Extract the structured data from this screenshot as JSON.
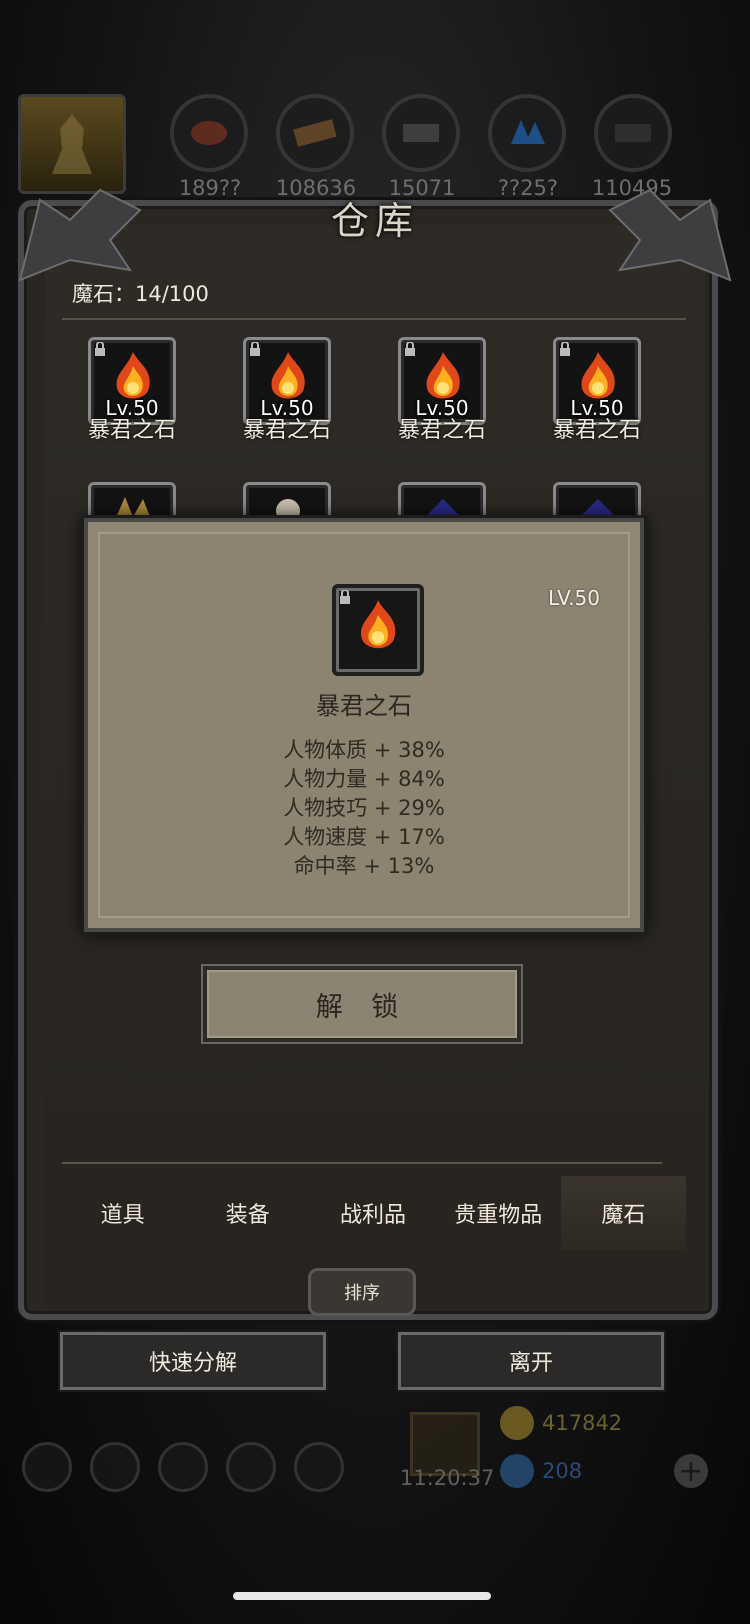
{
  "resources": {
    "values": [
      "189??",
      "108636",
      "15071",
      "??25?",
      "110495"
    ]
  },
  "warehouse": {
    "title": "仓库",
    "count_label": "魔石：14/100"
  },
  "items": [
    {
      "name": "暴君之石",
      "level": "Lv.50"
    },
    {
      "name": "暴君之石",
      "level": "Lv.50"
    },
    {
      "name": "暴君之石",
      "level": "Lv.50"
    },
    {
      "name": "暴君之石",
      "level": "Lv.50"
    }
  ],
  "popup": {
    "level": "LV.50",
    "name": "暴君之石",
    "stats": [
      "人物体质 + 38%",
      "人物力量 + 84%",
      "人物技巧 + 29%",
      "人物速度 + 17%",
      "命中率 + 13%"
    ],
    "unlock_label": "解 锁"
  },
  "tabs": [
    {
      "label": "道具",
      "active": false
    },
    {
      "label": "装备",
      "active": false
    },
    {
      "label": "战利品",
      "active": false
    },
    {
      "label": "贵重物品",
      "active": false
    },
    {
      "label": "魔石",
      "active": true
    }
  ],
  "sort_label": "排序",
  "actions": {
    "decompose_label": "快速分解",
    "leave_label": "离开"
  },
  "footer": {
    "time": "11:20:37",
    "gold": "417842",
    "gems": "208"
  }
}
